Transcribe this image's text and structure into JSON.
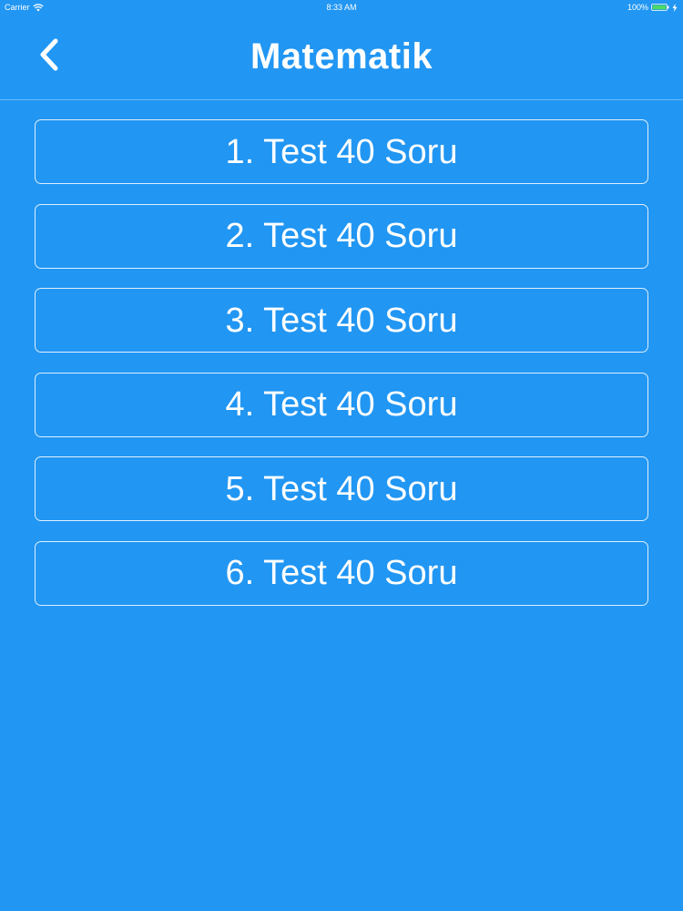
{
  "status_bar": {
    "carrier": "Carrier",
    "time": "8:33 AM",
    "battery": "100%",
    "wifi_icon": "wifi-icon",
    "battery_icon": "battery-icon",
    "charging_icon": "bolt-icon"
  },
  "nav": {
    "title": "Matematik",
    "back_icon": "chevron-left-icon"
  },
  "tests": [
    {
      "label": "1. Test 40 Soru"
    },
    {
      "label": "2. Test 40 Soru"
    },
    {
      "label": "3. Test 40 Soru"
    },
    {
      "label": "4. Test 40 Soru"
    },
    {
      "label": "5. Test 40 Soru"
    },
    {
      "label": "6. Test 40 Soru"
    }
  ],
  "colors": {
    "background": "#2196F3",
    "text": "#FFFFFF",
    "battery_fill": "#4CD964"
  }
}
